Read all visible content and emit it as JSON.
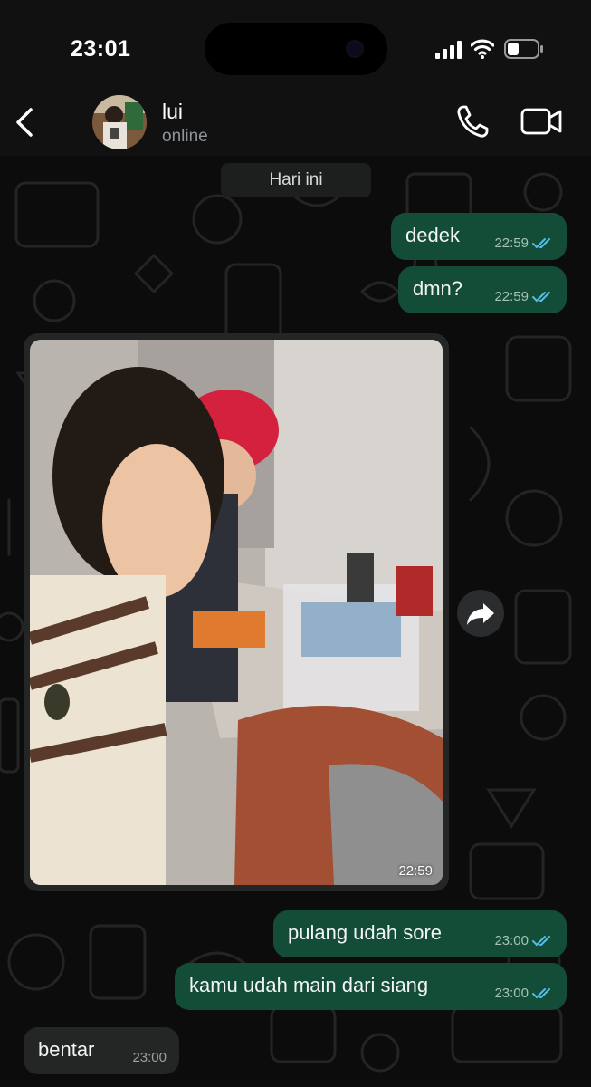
{
  "status_bar": {
    "time": "23:01"
  },
  "header": {
    "contact_name": "lui",
    "contact_status": "online"
  },
  "date_divider": "Hari ini",
  "messages": [
    {
      "direction": "outgoing",
      "text": "dedek",
      "time": "22:59",
      "read": true
    },
    {
      "direction": "outgoing",
      "text": "dmn?",
      "time": "22:59",
      "read": true
    },
    {
      "direction": "incoming",
      "type": "photo",
      "time": "22:59"
    },
    {
      "direction": "outgoing",
      "text": "pulang udah sore",
      "time": "23:00",
      "read": true
    },
    {
      "direction": "outgoing",
      "text": "kamu udah main dari siang",
      "time": "23:00",
      "read": true
    },
    {
      "direction": "incoming",
      "text": "bentar",
      "time": "23:00"
    }
  ],
  "colors": {
    "outgoing_bubble": "#144d37",
    "incoming_bubble": "#242626",
    "read_tick": "#53bdeb"
  }
}
